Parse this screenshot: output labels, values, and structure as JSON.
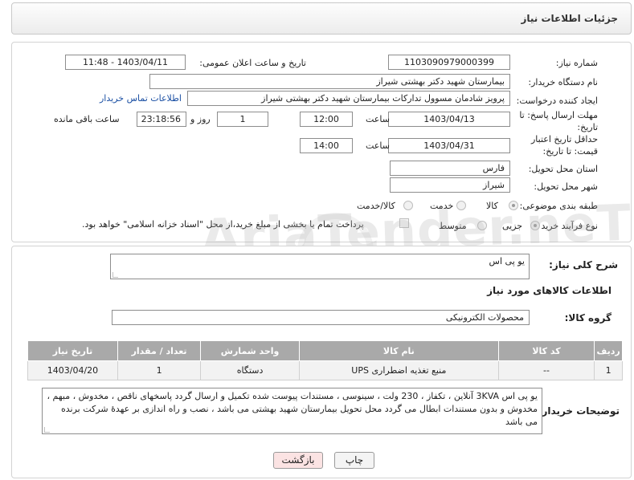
{
  "header": {
    "title": "جزئیات اطلاعات نیاز"
  },
  "form": {
    "need_number": {
      "label": "شماره نیاز:",
      "value": "1103090979000399"
    },
    "announce_datetime": {
      "label": "تاریخ و ساعت اعلان عمومی:",
      "value": "1403/04/11 - 11:48"
    },
    "buyer_org": {
      "label": "نام دستگاه خریدار:",
      "value": "بیمارستان شهید دکتر بهشتی شیراز"
    },
    "requester": {
      "label": "ایجاد کننده درخواست:",
      "value": "پرویز شادمان مسوول تدارکات بیمارستان شهید دکتر بهشتی شیراز",
      "contact_link": "اطلاعات تماس خریدار"
    },
    "reply_deadline": {
      "label": "مهلت ارسال پاسخ: تا تاریخ:",
      "date": "1403/04/13",
      "time_label": "ساعت",
      "time": "12:00",
      "days": "1",
      "days_label": "روز و",
      "remaining": "23:18:56",
      "remaining_label": "ساعت باقی مانده"
    },
    "price_validity": {
      "label": "حداقل تاریخ اعتبار قیمت: تا تاریخ:",
      "date": "1403/04/31",
      "time_label": "ساعت",
      "time": "14:00"
    },
    "province": {
      "label": "استان محل تحویل:",
      "value": "فارس"
    },
    "city": {
      "label": "شهر محل تحویل:",
      "value": "شیراز"
    },
    "category": {
      "label": "طبقه بندی موضوعی:",
      "options": [
        "کالا",
        "خدمت",
        "کالا/خدمت"
      ],
      "selected": "کالا"
    },
    "process_type": {
      "label": "نوع فرآیند خرید :",
      "options": [
        "جزیی",
        "متوسط"
      ],
      "selected": "جزیی",
      "payment_note": "پرداخت تمام یا بخشی از مبلغ خرید،از محل \"اسناد خزانه اسلامی\" خواهد بود."
    }
  },
  "description": {
    "label": "شرح کلی نیاز:",
    "value": "یو پی اس"
  },
  "goods_section": {
    "title": "اطلاعات کالاهای مورد نیاز",
    "group_label": "گروه کالا:",
    "group_value": "محصولات الکترونیکی"
  },
  "table": {
    "headers": [
      "ردیف",
      "کد کالا",
      "نام کالا",
      "واحد شمارش",
      "تعداد / مقدار",
      "تاریخ نیاز"
    ],
    "rows": [
      [
        "1",
        "--",
        "منبع تغذیه اضطراری UPS",
        "دستگاه",
        "1",
        "1403/04/20"
      ]
    ]
  },
  "buyer_notes": {
    "label": "توضیحات خریدار:",
    "value": "یو پی اس 3KVA آنلاین ، تکفاز ، 230 ولت ، سینوسی ، مستندات پیوست شده تکمیل و ارسال گردد پاسخهای ناقص ، مخدوش ، مبهم ، مخدوش و بدون مستندات ابطال می گردد محل تحویل بیمارستان شهید بهشتی می باشد ، نصب و راه اندازی بر عهدهٔ شرکت برنده می باشد"
  },
  "buttons": {
    "print": "چاپ",
    "back": "بازگشت"
  },
  "watermark": "AriaTender.neT"
}
